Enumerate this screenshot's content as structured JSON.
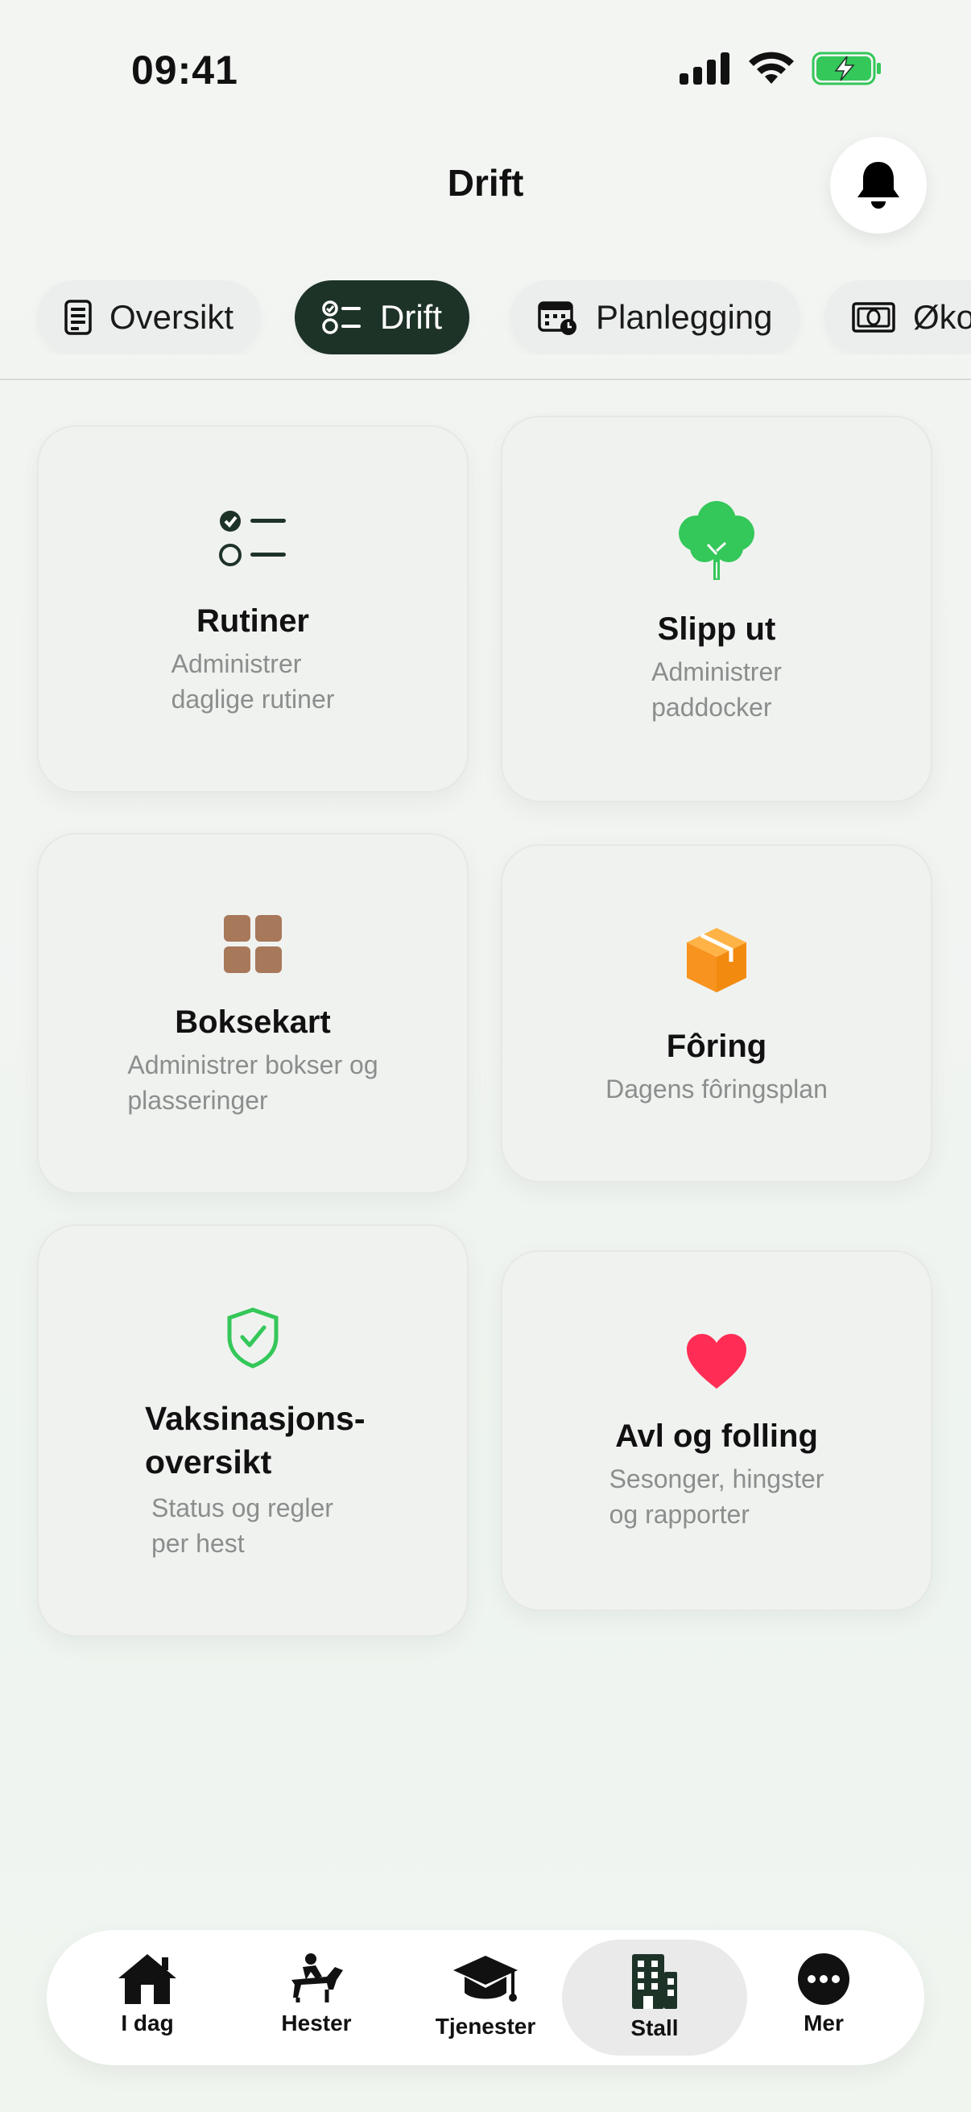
{
  "status_bar": {
    "time": "09:41"
  },
  "header": {
    "title": "Drift"
  },
  "tabs": [
    {
      "label": "Oversikt",
      "icon": "document-icon",
      "active": false
    },
    {
      "label": "Drift",
      "icon": "checklist-icon",
      "active": true
    },
    {
      "label": "Planlegging",
      "icon": "calendar-icon",
      "active": false
    },
    {
      "label": "Øko",
      "icon": "money-icon",
      "active": false
    }
  ],
  "cards": [
    {
      "title": "Rutiner",
      "subtitle_lines": [
        "Administrer",
        "daglige rutiner"
      ],
      "icon": "checklist-icon",
      "color": "#1e3328"
    },
    {
      "title": "Slipp ut",
      "subtitle_lines": [
        "Administrer",
        "paddocker"
      ],
      "icon": "tree-icon",
      "color": "#34c759"
    },
    {
      "title": "Boksekart",
      "subtitle_lines": [
        "Administrer bokser og",
        "plasseringer"
      ],
      "icon": "grid-icon",
      "color": "#a8785a"
    },
    {
      "title": "Fôring",
      "subtitle_lines": [
        "Dagens fôringsplan"
      ],
      "icon": "box-icon",
      "color": "#f7931e"
    },
    {
      "title_lines": [
        "Vaksinasjons-",
        "oversikt"
      ],
      "subtitle_lines": [
        "Status og regler",
        "per hest"
      ],
      "icon": "shield-check-icon",
      "color": "#34c759"
    },
    {
      "title": "Avl og folling",
      "subtitle_lines": [
        "Sesonger, hingster",
        "og rapporter"
      ],
      "icon": "heart-icon",
      "color": "#ff2d55"
    }
  ],
  "bottom_nav": [
    {
      "label": "I dag",
      "icon": "home-icon",
      "active": false
    },
    {
      "label": "Hester",
      "icon": "horse-rider-icon",
      "active": false
    },
    {
      "label": "Tjenester",
      "icon": "graduation-cap-icon",
      "active": false
    },
    {
      "label": "Stall",
      "icon": "building-icon",
      "active": true
    },
    {
      "label": "Mer",
      "icon": "more-icon",
      "active": false
    }
  ]
}
